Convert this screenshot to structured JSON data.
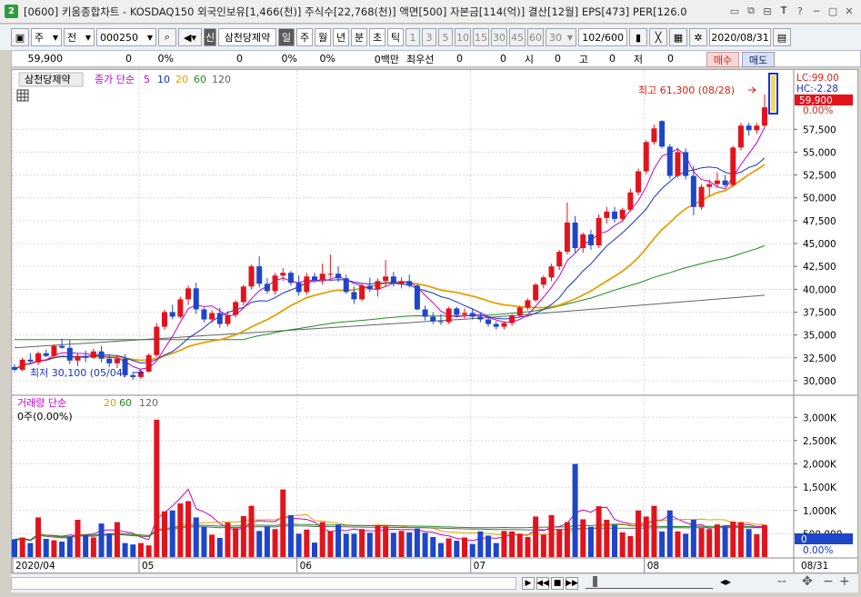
{
  "window": {
    "badge": "2",
    "title": "[0600] 키움종합차트 - KOSDAQ150 외국인보유[1,466(천)] 주식수[22,768(천)] 액면[500] 자본금[114(억)] 결산[12월] EPS[473] PER[126.0",
    "buttons": [
      "▭",
      "⧉",
      "⊟",
      "𝐓",
      "?",
      "─",
      "▢",
      "✕"
    ]
  },
  "toolbar": {
    "period_select": "주",
    "market_select": "전",
    "code_value": "000250",
    "name_badge": "신",
    "stock_name": "삼천당제약",
    "period_tabs": [
      "일",
      "주",
      "월",
      "년",
      "분",
      "초",
      "틱"
    ],
    "active_period": "일",
    "minute_options": [
      "1",
      "3",
      "5",
      "10",
      "15",
      "30",
      "45",
      "60"
    ],
    "interval_value": "30",
    "count_value": "102",
    "count_total": "/600",
    "date_value": "2020/08/31"
  },
  "info": {
    "price": "59,900",
    "change": "0",
    "change_pct": "0%",
    "volume": "0",
    "vol_pct": "0%",
    "vol_pct2": "0%",
    "amount": "0백만",
    "best_label": "최우선",
    "best_value": "0",
    "best_value2": "0",
    "open_label": "시",
    "open_value": "0",
    "high_label": "고",
    "high_value": "0",
    "low_label": "저",
    "low_value": "0",
    "buy_label": "매수",
    "sell_label": "매도"
  },
  "legend_price": {
    "name": "삼천당제약",
    "series_label": "종가 단순",
    "ma": [
      "5",
      "10",
      "20",
      "60",
      "120"
    ],
    "ma_colors": [
      "#c800c8",
      "#1432c8",
      "#e6a000",
      "#1e8c1e",
      "#646464"
    ]
  },
  "legend_volume": {
    "series_label": "거래량 단순",
    "ma": [
      "5",
      "20",
      "60",
      "120"
    ],
    "ma_colors": [
      "#c800c8",
      "#e6a000",
      "#1e8c1e",
      "#646464"
    ],
    "summary": "0주(0.00%)"
  },
  "annotations": {
    "high": "최고 61,300 (08/28)",
    "low": "최저 30,100 (05/04)"
  },
  "price_axis": {
    "lc": "LC:99.00",
    "hc": "HC:-2.28",
    "current": "59,900",
    "current_pct": "0.00%",
    "ticks": [
      "57,500",
      "55,000",
      "52,500",
      "50,000",
      "47,500",
      "45,000",
      "42,500",
      "40,000",
      "37,500",
      "35,000",
      "32,500",
      "30,000"
    ]
  },
  "volume_axis": {
    "ticks": [
      "3,000K",
      "2,500K",
      "2,000K",
      "1,500K",
      "1,000K",
      "500,000"
    ],
    "current": "0",
    "current_pct": "0.00%"
  },
  "x_axis": {
    "labels": [
      "2020/04",
      "05",
      "06",
      "07",
      "08"
    ],
    "end_label": "08/31"
  },
  "colors": {
    "up": "#e1141e",
    "down": "#1e46c8",
    "ma5": "#c800c8",
    "ma10": "#1432c8",
    "ma20": "#e6a000",
    "ma60": "#1e8c1e",
    "ma120": "#646464"
  },
  "chart_data": {
    "type": "candlestick",
    "ylim": [
      29000,
      62000
    ],
    "vol_ylim": [
      0,
      3200
    ],
    "vol_unit": "K",
    "candles": [
      [
        31500,
        31800,
        31000,
        31200
      ],
      [
        31200,
        32500,
        31000,
        32300
      ],
      [
        32300,
        33000,
        31900,
        32100
      ],
      [
        32000,
        33200,
        31700,
        33000
      ],
      [
        33000,
        33400,
        32600,
        32700
      ],
      [
        32700,
        34000,
        32500,
        33800
      ],
      [
        33800,
        34600,
        33500,
        33600
      ],
      [
        33600,
        34500,
        31800,
        32200
      ],
      [
        32200,
        33000,
        31600,
        32700
      ],
      [
        32700,
        33300,
        32000,
        32500
      ],
      [
        32500,
        33500,
        32400,
        33200
      ],
      [
        33200,
        33800,
        32000,
        32400
      ],
      [
        32400,
        32900,
        31500,
        31900
      ],
      [
        31900,
        32800,
        31400,
        32400
      ],
      [
        32400,
        32900,
        30400,
        30600
      ],
      [
        30600,
        31000,
        30100,
        30400
      ],
      [
        30400,
        31200,
        30200,
        31000
      ],
      [
        31000,
        33000,
        30900,
        32800
      ],
      [
        32800,
        36300,
        32600,
        35900
      ],
      [
        35900,
        37800,
        35600,
        37500
      ],
      [
        37500,
        38300,
        36700,
        37000
      ],
      [
        37000,
        39200,
        36800,
        38900
      ],
      [
        38900,
        40400,
        38300,
        40100
      ],
      [
        40100,
        40700,
        37300,
        37800
      ],
      [
        37800,
        38000,
        36400,
        36700
      ],
      [
        36700,
        37700,
        36300,
        37400
      ],
      [
        37400,
        38000,
        35800,
        36200
      ],
      [
        36200,
        37600,
        35900,
        37200
      ],
      [
        37200,
        38800,
        36900,
        38600
      ],
      [
        38600,
        40500,
        38200,
        40300
      ],
      [
        40300,
        42700,
        40000,
        42500
      ],
      [
        42500,
        43600,
        40200,
        40600
      ],
      [
        40600,
        41200,
        39500,
        39800
      ],
      [
        39800,
        41800,
        39400,
        41500
      ],
      [
        41500,
        42300,
        40900,
        41800
      ],
      [
        41800,
        42000,
        40400,
        40700
      ],
      [
        40700,
        41500,
        39300,
        39700
      ],
      [
        39700,
        41800,
        39400,
        41400
      ],
      [
        41400,
        41800,
        40700,
        41000
      ],
      [
        41000,
        42800,
        40500,
        41700
      ],
      [
        41700,
        43800,
        41200,
        41700
      ],
      [
        41700,
        42500,
        40800,
        41200
      ],
      [
        41200,
        41600,
        39500,
        39700
      ],
      [
        39700,
        40300,
        38400,
        38900
      ],
      [
        38900,
        40600,
        38700,
        40400
      ],
      [
        40400,
        41300,
        39700,
        40000
      ],
      [
        40000,
        41200,
        39200,
        40900
      ],
      [
        40900,
        43200,
        40300,
        41400
      ],
      [
        41400,
        41900,
        40300,
        40600
      ],
      [
        40600,
        41300,
        40100,
        40900
      ],
      [
        40900,
        41600,
        40200,
        40400
      ],
      [
        40400,
        40600,
        37700,
        37800
      ],
      [
        37800,
        38200,
        36600,
        37000
      ],
      [
        37000,
        37500,
        36200,
        36500
      ],
      [
        36500,
        37300,
        36100,
        36400
      ],
      [
        36400,
        38100,
        36200,
        37900
      ],
      [
        37900,
        38100,
        36900,
        37200
      ],
      [
        37200,
        37900,
        36800,
        37400
      ],
      [
        37400,
        37800,
        36700,
        37000
      ],
      [
        37000,
        37500,
        36400,
        36700
      ],
      [
        36700,
        36900,
        35900,
        36200
      ],
      [
        36200,
        36500,
        35600,
        35900
      ],
      [
        35900,
        36500,
        35600,
        36300
      ],
      [
        36300,
        37300,
        36000,
        37100
      ],
      [
        37100,
        38200,
        36900,
        38000
      ],
      [
        38000,
        39000,
        37700,
        38800
      ],
      [
        38800,
        40700,
        38600,
        40500
      ],
      [
        40500,
        41500,
        40100,
        41300
      ],
      [
        41300,
        42800,
        40900,
        42500
      ],
      [
        42500,
        44300,
        42100,
        44100
      ],
      [
        44100,
        49500,
        43800,
        47300
      ],
      [
        47300,
        48000,
        44000,
        44500
      ],
      [
        44500,
        46200,
        44000,
        46000
      ],
      [
        46000,
        46500,
        44300,
        44800
      ],
      [
        44800,
        48200,
        44500,
        47800
      ],
      [
        47800,
        49000,
        47200,
        48500
      ],
      [
        48500,
        49000,
        47300,
        47700
      ],
      [
        47700,
        48900,
        47400,
        48700
      ],
      [
        48700,
        51000,
        48500,
        50600
      ],
      [
        50600,
        53200,
        50300,
        52900
      ],
      [
        52900,
        56300,
        52600,
        56100
      ],
      [
        56100,
        58000,
        55800,
        57600
      ],
      [
        58400,
        58500,
        55400,
        55600
      ],
      [
        55600,
        55900,
        52100,
        52400
      ],
      [
        52400,
        55500,
        52200,
        55000
      ],
      [
        55000,
        55400,
        52000,
        52400
      ],
      [
        52400,
        53500,
        48100,
        49000
      ],
      [
        49000,
        51500,
        48700,
        51200
      ],
      [
        51200,
        52000,
        50200,
        51500
      ],
      [
        51500,
        52800,
        51100,
        51900
      ],
      [
        51900,
        52500,
        51200,
        51400
      ],
      [
        51400,
        55700,
        51200,
        55500
      ],
      [
        55500,
        58200,
        55200,
        57900
      ],
      [
        57900,
        58200,
        56800,
        57400
      ],
      [
        57400,
        58200,
        57000,
        57900
      ],
      [
        57900,
        61300,
        57700,
        59900
      ]
    ],
    "volumes": [
      380,
      420,
      300,
      850,
      390,
      360,
      330,
      440,
      800,
      470,
      420,
      720,
      510,
      750,
      300,
      270,
      300,
      250,
      2950,
      980,
      1000,
      1150,
      1200,
      850,
      650,
      480,
      410,
      740,
      620,
      880,
      1100,
      560,
      660,
      600,
      1450,
      900,
      500,
      590,
      310,
      750,
      560,
      700,
      500,
      500,
      600,
      520,
      680,
      660,
      520,
      560,
      530,
      610,
      520,
      430,
      300,
      400,
      350,
      420,
      280,
      550,
      460,
      300,
      560,
      550,
      500,
      430,
      870,
      480,
      900,
      600,
      750,
      2000,
      810,
      650,
      1090,
      800,
      690,
      530,
      450,
      1000,
      870,
      1100,
      550,
      1000,
      550,
      500,
      800,
      620,
      600,
      700,
      660,
      760,
      750,
      600,
      490,
      690
    ]
  }
}
